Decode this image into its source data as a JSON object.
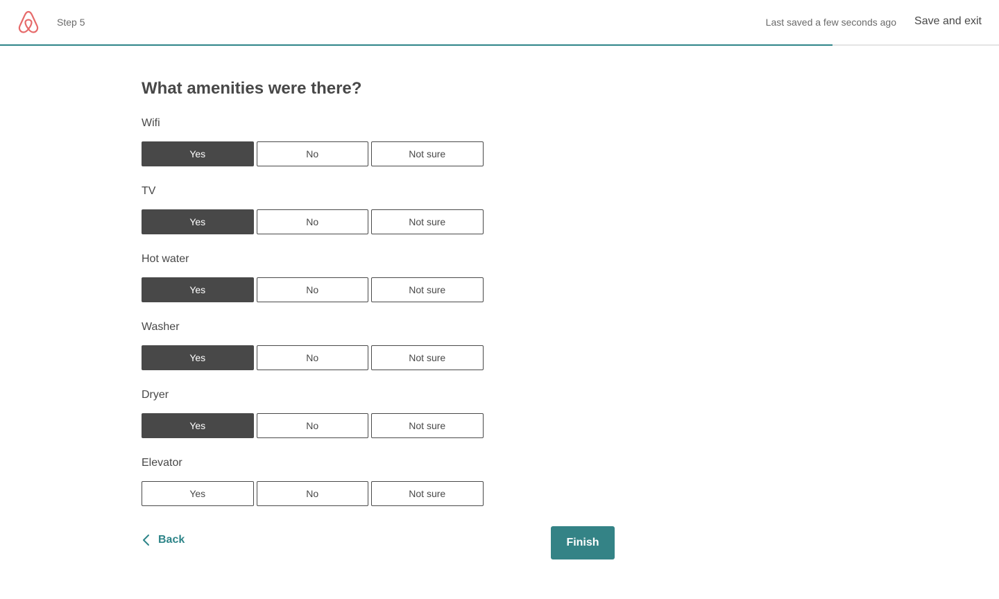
{
  "header": {
    "step_label": "Step 5",
    "saved_text": "Last saved a few seconds ago",
    "save_exit_label": "Save and exit",
    "logo_icon": "airbnb-logo-icon",
    "brand_color": "#E66A6A",
    "progress_fraction": 0.833
  },
  "page": {
    "title": "What amenities were there?"
  },
  "option_labels": {
    "yes": "Yes",
    "no": "No",
    "not_sure": "Not sure"
  },
  "amenities": [
    {
      "label": "Wifi",
      "selected": "yes"
    },
    {
      "label": "TV",
      "selected": "yes"
    },
    {
      "label": "Hot water",
      "selected": "yes"
    },
    {
      "label": "Washer",
      "selected": "yes"
    },
    {
      "label": "Dryer",
      "selected": "yes"
    },
    {
      "label": "Elevator",
      "selected": ""
    }
  ],
  "footer": {
    "back_label": "Back",
    "finish_label": "Finish",
    "accent_color": "#348386"
  }
}
